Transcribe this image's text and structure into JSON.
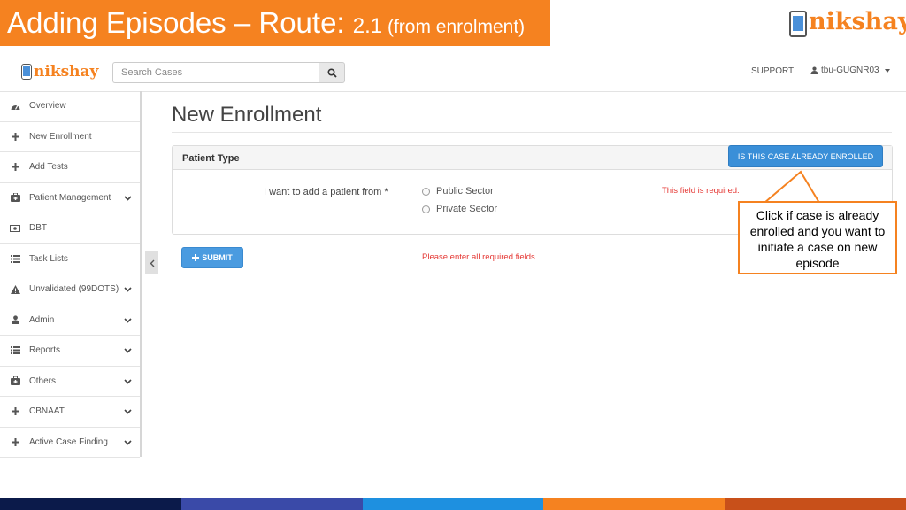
{
  "slide": {
    "title_main": "Adding Episodes – Route: ",
    "title_version": "2.1",
    "title_sub": " (from enrolment)",
    "logo_text": "nikshay",
    "banner_color": "#f58220"
  },
  "header": {
    "logo_text": "nikshay",
    "search_placeholder": "Search Cases",
    "search_icon": "search-icon",
    "support_label": "SUPPORT",
    "user_label": "tbu-GUGNR03"
  },
  "sidebar": {
    "items": [
      {
        "label": "Overview",
        "icon": "dashboard-icon",
        "has_chevron": false
      },
      {
        "label": "New Enrollment",
        "icon": "plus-icon",
        "has_chevron": false
      },
      {
        "label": "Add Tests",
        "icon": "plus-icon",
        "has_chevron": false
      },
      {
        "label": "Patient Management",
        "icon": "medkit-icon",
        "has_chevron": true
      },
      {
        "label": "DBT",
        "icon": "money-icon",
        "has_chevron": false
      },
      {
        "label": "Task Lists",
        "icon": "list-icon",
        "has_chevron": false
      },
      {
        "label": "Unvalidated (99DOTS)",
        "icon": "warning-icon",
        "has_chevron": true
      },
      {
        "label": "Admin",
        "icon": "user-icon",
        "has_chevron": true
      },
      {
        "label": "Reports",
        "icon": "list-icon",
        "has_chevron": true
      },
      {
        "label": "Others",
        "icon": "medkit-icon",
        "has_chevron": true
      },
      {
        "label": "CBNAAT",
        "icon": "plus-icon",
        "has_chevron": true
      },
      {
        "label": "Active Case Finding",
        "icon": "plus-icon",
        "has_chevron": true
      }
    ]
  },
  "main": {
    "page_title": "New Enrollment",
    "panel_title": "Patient Type",
    "enrolled_button": "IS THIS CASE ALREADY ENROLLED",
    "field_label": "I want to add a patient from *",
    "options": [
      "Public Sector",
      "Private Sector"
    ],
    "field_error": "This field is required.",
    "submit_label": "SUBMIT",
    "form_error": "Please enter all required fields."
  },
  "callout": {
    "text": "Click if case is already enrolled and you want to initiate a case on new episode"
  },
  "footer_colors": [
    "#0b1a4a",
    "#3a4aa8",
    "#1e90e0",
    "#f58220",
    "#c8501a"
  ]
}
